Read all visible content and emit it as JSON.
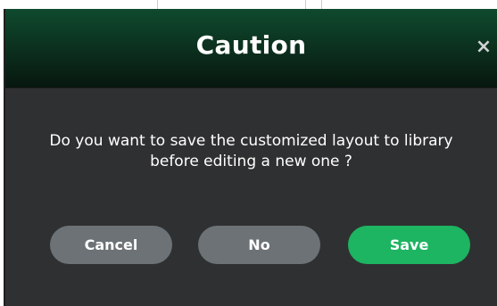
{
  "dialog": {
    "title": "Caution",
    "close_glyph": "×",
    "message_line1": "Do you want to save the customized layout to library",
    "message_line2": "before editing a new one ?",
    "buttons": {
      "cancel": "Cancel",
      "no": "No",
      "save": "Save"
    }
  },
  "colors": {
    "title_gradient_top": "#0f4a2e",
    "title_gradient_bottom": "#07170f",
    "body_background": "#2f3031",
    "secondary_button": "#6c7276",
    "primary_button": "#1db462"
  },
  "icons": {
    "close": "close-icon"
  }
}
